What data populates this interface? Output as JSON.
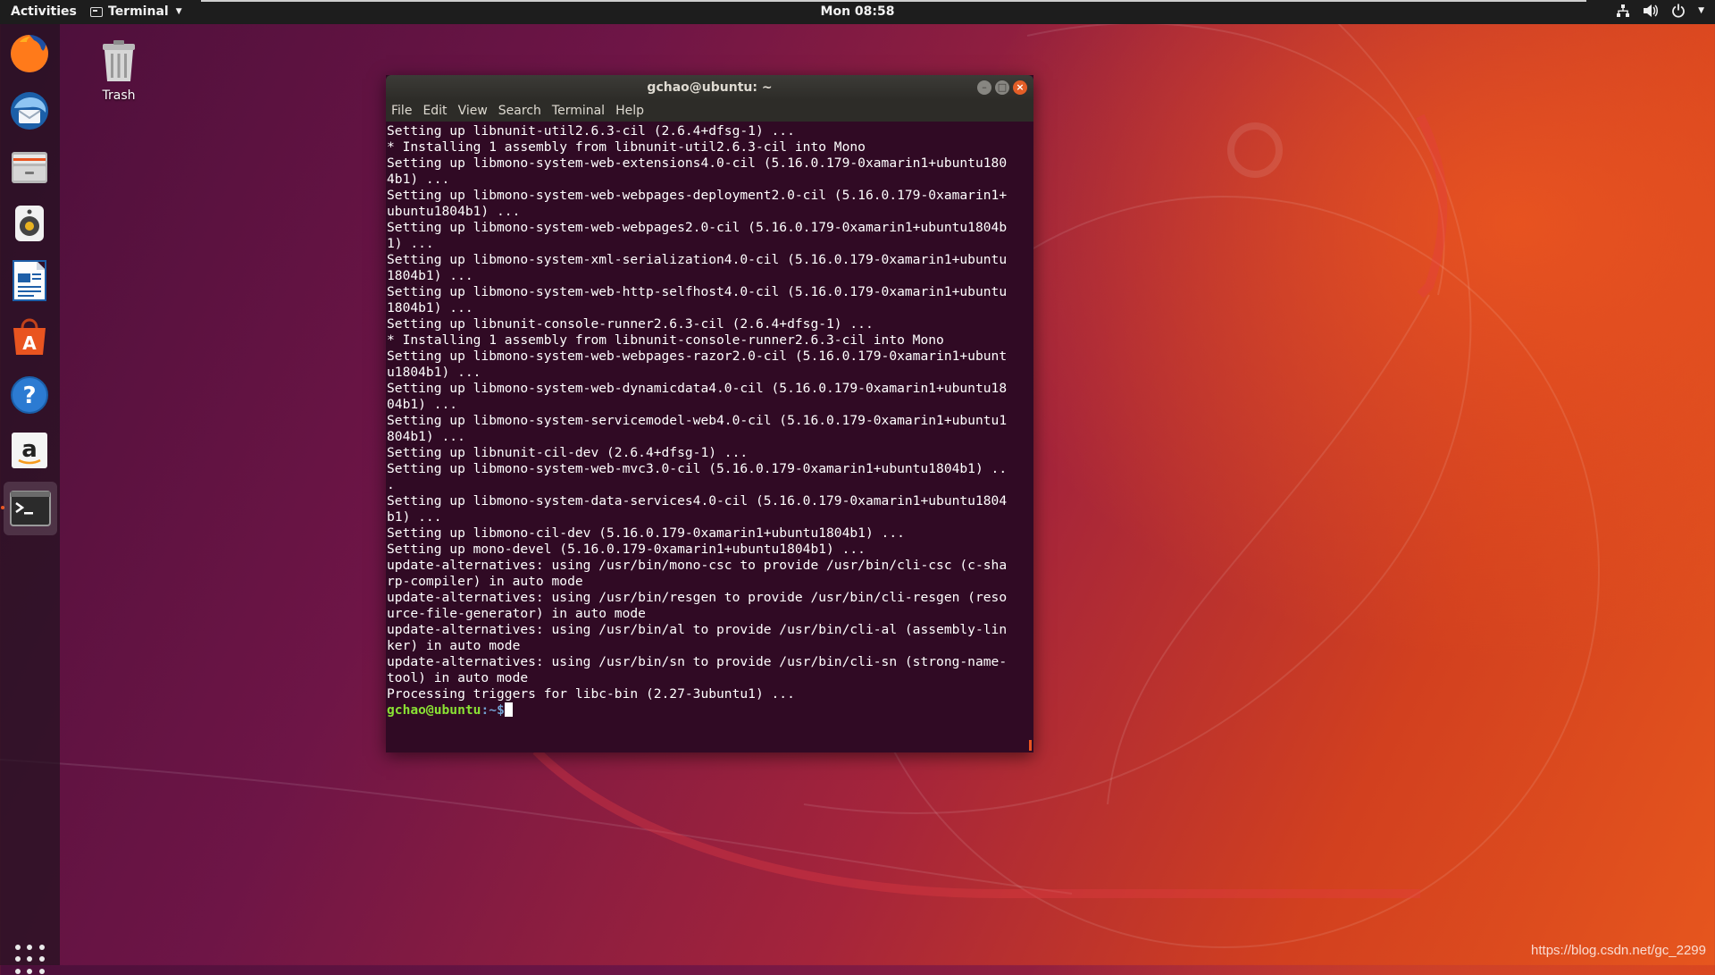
{
  "topbar": {
    "activities_label": "Activities",
    "app_menu_label": "Terminal",
    "clock": "Mon 08:58",
    "tray_icons": [
      "network-icon",
      "volume-icon",
      "power-icon",
      "chevron-down-icon"
    ]
  },
  "dock": {
    "items": [
      {
        "name": "firefox-icon"
      },
      {
        "name": "thunderbird-icon"
      },
      {
        "name": "files-icon"
      },
      {
        "name": "rhythmbox-icon"
      },
      {
        "name": "libreoffice-writer-icon"
      },
      {
        "name": "ubuntu-software-icon"
      },
      {
        "name": "help-icon"
      },
      {
        "name": "amazon-icon"
      },
      {
        "name": "terminal-icon",
        "active": true
      }
    ],
    "show_apps_icon": "app-grid-icon"
  },
  "desktop": {
    "trash_label": "Trash"
  },
  "terminal": {
    "title": "gchao@ubuntu: ~",
    "menu": [
      "File",
      "Edit",
      "View",
      "Search",
      "Terminal",
      "Help"
    ],
    "lines": [
      "Setting up libnunit-util2.6.3-cil (2.6.4+dfsg-1) ...",
      "* Installing 1 assembly from libnunit-util2.6.3-cil into Mono",
      "Setting up libmono-system-web-extensions4.0-cil (5.16.0.179-0xamarin1+ubuntu180",
      "4b1) ...",
      "Setting up libmono-system-web-webpages-deployment2.0-cil (5.16.0.179-0xamarin1+",
      "ubuntu1804b1) ...",
      "Setting up libmono-system-web-webpages2.0-cil (5.16.0.179-0xamarin1+ubuntu1804b",
      "1) ...",
      "Setting up libmono-system-xml-serialization4.0-cil (5.16.0.179-0xamarin1+ubuntu",
      "1804b1) ...",
      "Setting up libmono-system-web-http-selfhost4.0-cil (5.16.0.179-0xamarin1+ubuntu",
      "1804b1) ...",
      "Setting up libnunit-console-runner2.6.3-cil (2.6.4+dfsg-1) ...",
      "* Installing 1 assembly from libnunit-console-runner2.6.3-cil into Mono",
      "Setting up libmono-system-web-webpages-razor2.0-cil (5.16.0.179-0xamarin1+ubunt",
      "u1804b1) ...",
      "Setting up libmono-system-web-dynamicdata4.0-cil (5.16.0.179-0xamarin1+ubuntu18",
      "04b1) ...",
      "Setting up libmono-system-servicemodel-web4.0-cil (5.16.0.179-0xamarin1+ubuntu1",
      "804b1) ...",
      "Setting up libnunit-cil-dev (2.6.4+dfsg-1) ...",
      "Setting up libmono-system-web-mvc3.0-cil (5.16.0.179-0xamarin1+ubuntu1804b1) ..",
      ".",
      "Setting up libmono-system-data-services4.0-cil (5.16.0.179-0xamarin1+ubuntu1804",
      "b1) ...",
      "Setting up libmono-cil-dev (5.16.0.179-0xamarin1+ubuntu1804b1) ...",
      "Setting up mono-devel (5.16.0.179-0xamarin1+ubuntu1804b1) ...",
      "update-alternatives: using /usr/bin/mono-csc to provide /usr/bin/cli-csc (c-sha",
      "rp-compiler) in auto mode",
      "update-alternatives: using /usr/bin/resgen to provide /usr/bin/cli-resgen (reso",
      "urce-file-generator) in auto mode",
      "update-alternatives: using /usr/bin/al to provide /usr/bin/cli-al (assembly-lin",
      "ker) in auto mode",
      "update-alternatives: using /usr/bin/sn to provide /usr/bin/cli-sn (strong-name-",
      "tool) in auto mode",
      "Processing triggers for libc-bin (2.27-3ubuntu1) ..."
    ],
    "prompt_user": "gchao@ubuntu",
    "prompt_path": ":~$"
  },
  "watermark": "https://blog.csdn.net/gc_2299",
  "colors": {
    "accent": "#e95420",
    "terminal_bg": "#300a24",
    "prompt_green": "#8ae234",
    "prompt_blue": "#729fcf"
  }
}
